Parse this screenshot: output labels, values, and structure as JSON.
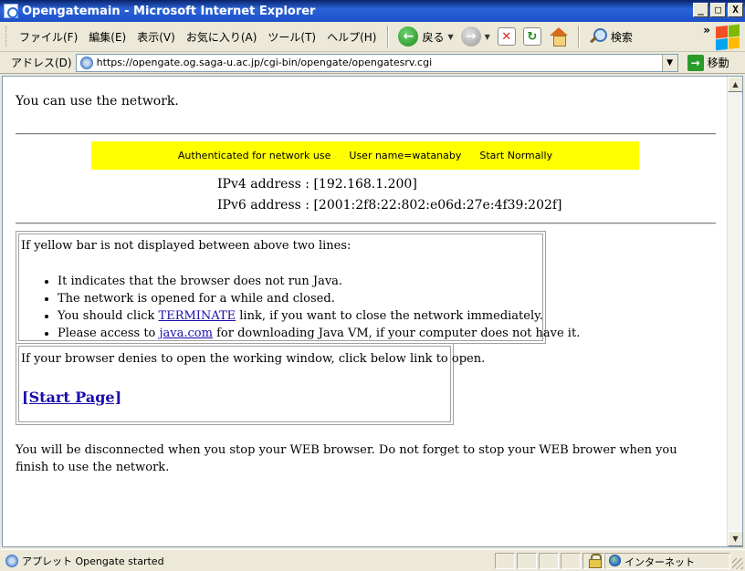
{
  "window": {
    "title": "Opengatemain - Microsoft Internet Explorer",
    "buttons": [
      "_",
      "□",
      "X"
    ]
  },
  "menu": {
    "items": [
      "ファイル(F)",
      "編集(E)",
      "表示(V)",
      "お気に入り(A)",
      "ツール(T)",
      "ヘルプ(H)"
    ]
  },
  "toolbar": {
    "back_label": "戻る",
    "search_label": "検索",
    "more": "»"
  },
  "address": {
    "label": "アドレス(D)",
    "url": "https://opengate.og.saga-u.ac.jp/cgi-bin/opengate/opengatesrv.cgi",
    "go_label": "移動"
  },
  "page": {
    "intro": "You can use the network.",
    "yellow_bar": {
      "status": "Authenticated for network use",
      "user": "User name=watanaby",
      "start": "Start Normally"
    },
    "ipv4": "IPv4 address : [192.168.1.200]",
    "ipv6": "IPv6 address : [2001:2f8:22:802:e06d:27e:4f39:202f]",
    "box1": {
      "heading": "If yellow bar is not displayed between above two lines:",
      "items": [
        {
          "text": "It indicates that the browser does not run Java."
        },
        {
          "text": "The network is opened for a while and closed."
        },
        {
          "pre": "You should click ",
          "link": "TERMINATE",
          "post": " link, if you want to close the network immediately."
        },
        {
          "pre": "Please access to ",
          "link": "java.com",
          "post": " for downloading Java VM, if your computer does not have it."
        }
      ]
    },
    "box2": {
      "heading": "If your browser denies to open the working window, click below link to open.",
      "link": "[Start Page]"
    },
    "footer": "You will be disconnected when you stop your WEB browser. Do not forget to stop your WEB brower when you finish to use the network."
  },
  "status": {
    "text": "アプレット Opengate started",
    "zone": "インターネット"
  }
}
